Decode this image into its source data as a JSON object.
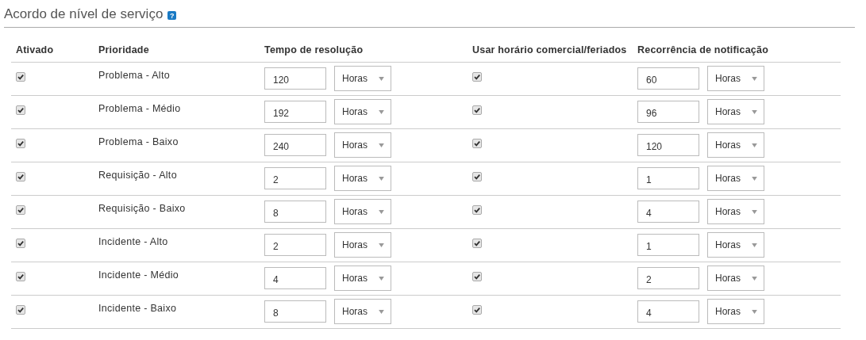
{
  "title": "Acordo de nível de serviço",
  "help_icon": "?",
  "columns": [
    "Ativado",
    "Prioridade",
    "Tempo de resolução",
    "Usar horário comercial/feriados",
    "Recorrência de notificação"
  ],
  "rows": [
    {
      "enabled": true,
      "priority": "Problema - Alto",
      "resolution": "120",
      "resolution_unit": "Horas",
      "business_hours": true,
      "recurrence": "60",
      "recurrence_unit": "Horas"
    },
    {
      "enabled": true,
      "priority": "Problema - Médio",
      "resolution": "192",
      "resolution_unit": "Horas",
      "business_hours": true,
      "recurrence": "96",
      "recurrence_unit": "Horas"
    },
    {
      "enabled": true,
      "priority": "Problema - Baixo",
      "resolution": "240",
      "resolution_unit": "Horas",
      "business_hours": true,
      "recurrence": "120",
      "recurrence_unit": "Horas"
    },
    {
      "enabled": true,
      "priority": "Requisição - Alto",
      "resolution": "2",
      "resolution_unit": "Horas",
      "business_hours": true,
      "recurrence": "1",
      "recurrence_unit": "Horas"
    },
    {
      "enabled": true,
      "priority": "Requisição - Baixo",
      "resolution": "8",
      "resolution_unit": "Horas",
      "business_hours": true,
      "recurrence": "4",
      "recurrence_unit": "Horas"
    },
    {
      "enabled": true,
      "priority": "Incidente - Alto",
      "resolution": "2",
      "resolution_unit": "Horas",
      "business_hours": true,
      "recurrence": "1",
      "recurrence_unit": "Horas"
    },
    {
      "enabled": true,
      "priority": "Incidente - Médio",
      "resolution": "4",
      "resolution_unit": "Horas",
      "business_hours": true,
      "recurrence": "2",
      "recurrence_unit": "Horas"
    },
    {
      "enabled": true,
      "priority": "Incidente - Baixo",
      "resolution": "8",
      "resolution_unit": "Horas",
      "business_hours": true,
      "recurrence": "4",
      "recurrence_unit": "Horas"
    }
  ]
}
